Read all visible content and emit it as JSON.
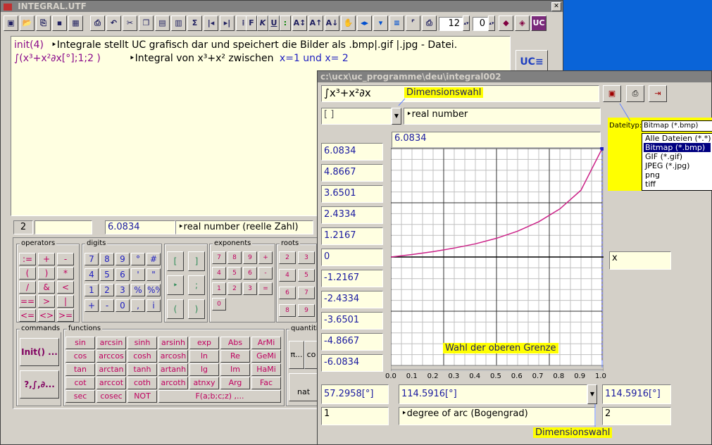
{
  "colors": {
    "desktop": "#0a64d8",
    "title_inactive": "#808080",
    "field_bg": "#ffffe1",
    "curve": "#cc2288",
    "highlight": "#ffff00",
    "select": "#000080"
  },
  "main": {
    "title": "INTEGRAL.UTF",
    "close": "✕",
    "toolbar": {
      "font_size": "12",
      "step": "0",
      "buttons": [
        "F",
        "K",
        "U",
        ":",
        "UC"
      ]
    },
    "editor": {
      "line1_cmd": "init(4)",
      "line1_comment": "‣Integrale stellt UC grafisch dar und speichert die Bilder als .bmp|.gif |.jpg - Datei.",
      "line2_cmd": "∫(x³+x²∂x[°];1;2 )",
      "line2_comment_a": "‣Integral von x³+x² zwischen",
      "line2_comment_b": "x=1 und x= 2"
    },
    "status": {
      "line": "2",
      "value": "6.0834",
      "type": "‣real number (reelle Zahl)"
    },
    "groups": {
      "operators": "operators",
      "digits": "digits",
      "exponents": "exponents",
      "roots": "roots",
      "commands": "commands",
      "functions": "functions",
      "quantities": "quantitie"
    },
    "operators": [
      ":=",
      "+",
      "-",
      "(",
      ")",
      "*",
      "/",
      "&",
      "<",
      "==",
      ">",
      "|",
      "<=",
      "<>",
      ">="
    ],
    "digits": [
      "7",
      "8",
      "9",
      "°",
      "#",
      "4",
      "5",
      "6",
      "'",
      "\"",
      "1",
      "2",
      "3",
      "%",
      "%‰",
      "+",
      "-",
      "0",
      ",",
      "i"
    ],
    "misc_keys": [
      "[",
      "]",
      "‣",
      ";",
      "(",
      ")"
    ],
    "exponents": [
      "7",
      "8",
      "9",
      "+",
      "4",
      "5",
      "6",
      "-",
      "1",
      "2",
      "3",
      "=",
      "0"
    ],
    "roots": [
      "2",
      "3",
      "4",
      "5",
      "6",
      "7",
      "8",
      "9"
    ],
    "commands": [
      "Init() ...",
      "?,∫,∂..."
    ],
    "functions": [
      "sin",
      "arcsin",
      "sinh",
      "arsinh",
      "exp",
      "Abs",
      "ArMi",
      "cos",
      "arccos",
      "cosh",
      "arcosh",
      "ln",
      "Re",
      "GeMi",
      "tan",
      "arctan",
      "tanh",
      "artanh",
      "lg",
      "Im",
      "HaMi",
      "cot",
      "arccot",
      "coth",
      "arcoth",
      "atnxy",
      "Arg",
      "Fac",
      "sec",
      "cosec",
      "NOT",
      "F(a;b;c;z) ,..."
    ],
    "quantity_keys": [
      "π...",
      "co",
      "nat"
    ]
  },
  "graph": {
    "title": "c:\\ucx\\uc_programme\\deu\\integral002",
    "formula": "∫x³+x²∂x",
    "dim_label_top": "Dimensionswahl",
    "unit_value": "[ ]",
    "type": "‣real number",
    "top_value": "6.0834",
    "y_values": [
      "6.0834",
      "4.8667",
      "3.6501",
      "2.4334",
      "1.2167",
      "0",
      "-1.2167",
      "-2.4334",
      "-3.6501",
      "-4.8667",
      "-6.0834"
    ],
    "x_axis_label": "x",
    "upper_bound_tag": "Wahl der oberen Grenze",
    "x_ticks": [
      "0.0",
      "0.1",
      "0.2",
      "0.3",
      "0.4",
      "0.5",
      "0.6",
      "0.7",
      "0.8",
      "0.9",
      "1.0"
    ],
    "bottom": {
      "lower_value": "57.2958[°]",
      "mid_value": "114.5916[°]",
      "upper_value": "114.5916[°]",
      "lower_count": "1",
      "unit_type": "‣degree of arc (Bogengrad)",
      "upper_count": "2"
    },
    "dim_label_bottom": "Dimensionswahl",
    "filetype": {
      "label": "Dateityp:",
      "selected": "Bitmap (*.bmp)",
      "options": [
        "Alle Dateien (*.*)",
        "Bitmap (*.bmp)",
        "GIF (*.gif)",
        "JPEG (*.jpg)",
        "png",
        "tiff"
      ]
    }
  },
  "chart_data": {
    "type": "line",
    "x": [
      0.0,
      0.1,
      0.2,
      0.3,
      0.4,
      0.5,
      0.6,
      0.7,
      0.8,
      0.9,
      1.0
    ],
    "y": [
      0,
      0.14,
      0.3,
      0.5,
      0.74,
      1.05,
      1.45,
      1.98,
      2.7,
      3.75,
      6.0834
    ],
    "xlim": [
      0,
      1
    ],
    "ylim": [
      -6.0834,
      6.0834
    ],
    "grid": true
  }
}
